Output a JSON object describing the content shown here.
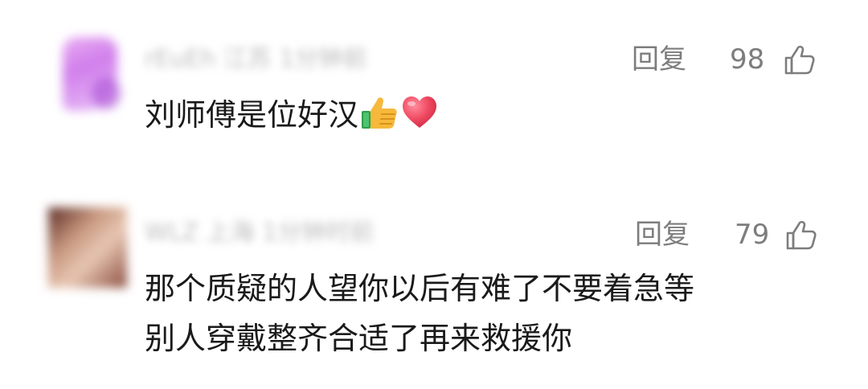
{
  "comments": [
    {
      "meta": "rEuEh 江苏 1分钟前",
      "reply_label": "回复",
      "likes": "98",
      "text": "刘师傅是位好汉",
      "emojis": [
        "thumbs-up-emoji",
        "red-heart-emoji"
      ]
    },
    {
      "meta": "WLZ 上海 1分钟",
      "meta_tail": "时前",
      "reply_label": "回复",
      "likes": "79",
      "text_lines": [
        "那个质疑的人望你以后有难了不要着急等",
        "别人穿戴整齐合适了再来救援你"
      ]
    }
  ],
  "icons": {
    "like": "thumbs-up-outline-icon"
  },
  "colors": {
    "secondary_text": "#7d7d7d",
    "primary_text": "#1a1a1a",
    "background": "#ffffff"
  }
}
